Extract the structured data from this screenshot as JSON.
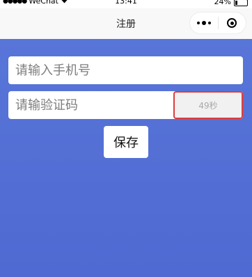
{
  "status_bar": {
    "signal": "●●●●●",
    "carrier": "WeChat",
    "wifi_icon": "wifi-icon",
    "time": "13:41",
    "battery": "24%"
  },
  "nav_bar": {
    "title": "注册",
    "more_icon": "more-icon",
    "close_icon": "close-icon"
  },
  "form": {
    "phone": {
      "value": "",
      "placeholder": "请输入手机号"
    },
    "code": {
      "value": "",
      "placeholder": "请输验证码"
    },
    "countdown_label": "49秒",
    "save_label": "保存"
  },
  "colors": {
    "background_gradient_top": "#5875d8",
    "background_gradient_bottom": "#4f6ad2",
    "countdown_border": "#e03b3b",
    "countdown_text": "#a8a8a8"
  }
}
